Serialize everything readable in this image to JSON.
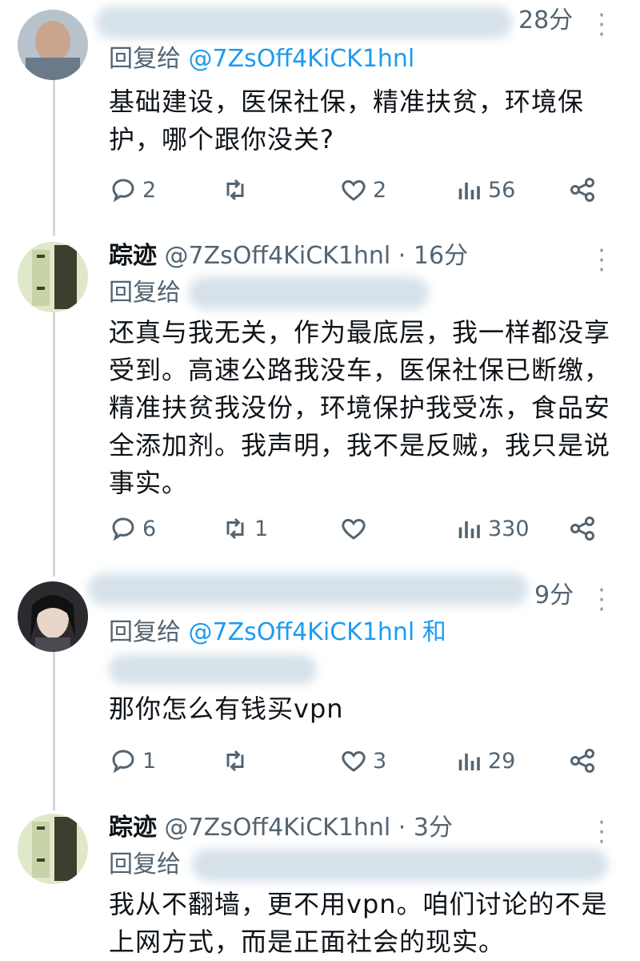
{
  "tweets": [
    {
      "time": "28分",
      "reply_prefix": "回复给",
      "reply_to": "@7ZsOff4KiCK1hnl",
      "text_lines": [
        "基础建设，医保社保，精准扶贫，环境保",
        "护，哪个跟你没关?"
      ],
      "replies": "2",
      "retweets": "",
      "likes": "2",
      "views": "56"
    },
    {
      "name": "踪迹",
      "handle": "@7ZsOff4KiCK1hnl · 16分",
      "reply_prefix": "回复给",
      "text_lines": [
        "还真与我无关，作为最底层，我一样都没享",
        "受到。高速公路我没车，医保社保已断缴，",
        "精准扶贫我没份，环境保护我受冻，食品安",
        "全添加剂。我声明，我不是反贼，我只是说",
        "事实。"
      ],
      "replies": "6",
      "retweets": "1",
      "likes": "",
      "views": "330"
    },
    {
      "time": "9分",
      "reply_prefix": "回复给",
      "reply_to": "@7ZsOff4KiCK1hnl 和",
      "text_lines": [
        "那你怎么有钱买vpn"
      ],
      "replies": "1",
      "retweets": "",
      "likes": "3",
      "views": "29"
    },
    {
      "name": "踪迹",
      "handle": "@7ZsOff4KiCK1hnl · 3分",
      "reply_prefix": "回复给",
      "text_lines": [
        "我从不翻墙，更不用vpn。咱们讨论的不是",
        "上网方式，而是正面社会的现实。"
      ]
    }
  ],
  "colors": {
    "accent": "#1d9bf0",
    "muted": "#536471",
    "line": "#cfd9de"
  }
}
